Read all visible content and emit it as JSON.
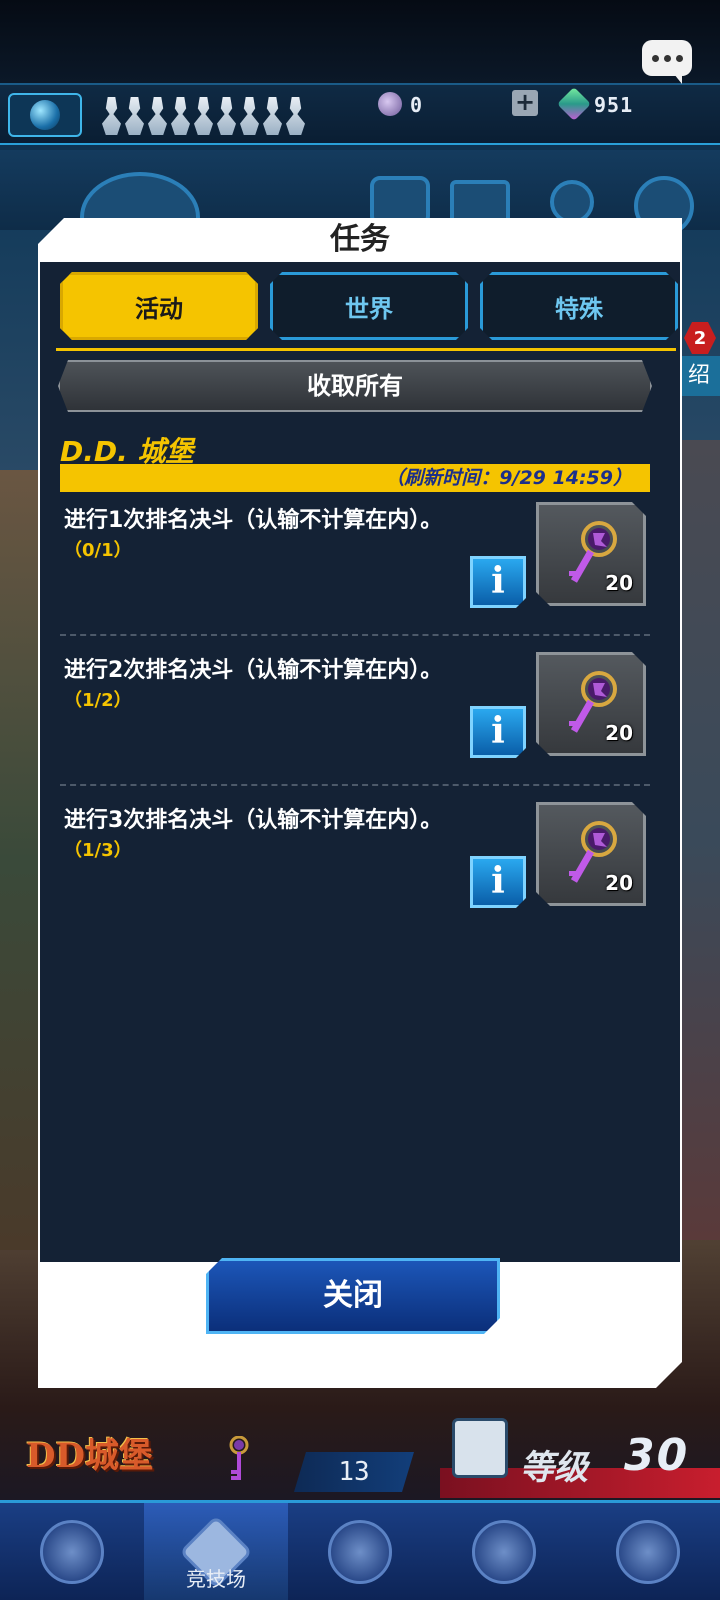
{
  "chat": {
    "icon": "chat-bubble-icon"
  },
  "status": {
    "orbs_value": "0",
    "gems_value": "951"
  },
  "dialog": {
    "title": "任务",
    "tabs": [
      {
        "label": "活动",
        "active": true
      },
      {
        "label": "世界",
        "active": false
      },
      {
        "label": "特殊",
        "active": false
      }
    ],
    "collect_all_label": "收取所有",
    "event_title": "D.D. 城堡",
    "refresh_text": "（刷新时间：9/29 14:59）",
    "missions": [
      {
        "text": "进行1次排名决斗（认输不计算在内）。",
        "progress": "（0/1）",
        "reward_qty": "20",
        "reward_icon": "purple-key-icon"
      },
      {
        "text": "进行2次排名决斗（认输不计算在内）。",
        "progress": "（1/2）",
        "reward_qty": "20",
        "reward_icon": "purple-key-icon"
      },
      {
        "text": "进行3次排名决斗（认输不计算在内）。",
        "progress": "（1/3）",
        "reward_qty": "20",
        "reward_icon": "purple-key-icon"
      }
    ],
    "close_label": "关闭"
  },
  "side": {
    "badge": "2",
    "label": "绍"
  },
  "hud": {
    "logo_text": "DD城堡",
    "key_count": "13",
    "level_label": "等级",
    "level_value": "30"
  },
  "nav": {
    "items": [
      {
        "label": "",
        "icon": "duelist-icon"
      },
      {
        "label": "竞技场",
        "icon": "crossed-swords-icon"
      },
      {
        "label": "",
        "icon": "shop-cart-icon"
      },
      {
        "label": "",
        "icon": "cards-icon"
      },
      {
        "label": "",
        "icon": "missions-icon"
      }
    ]
  },
  "colors": {
    "accent_yellow": "#f5c400",
    "panel": "#142235",
    "tab_blue": "#2a9ad8",
    "close_button": "#1c56b8"
  }
}
